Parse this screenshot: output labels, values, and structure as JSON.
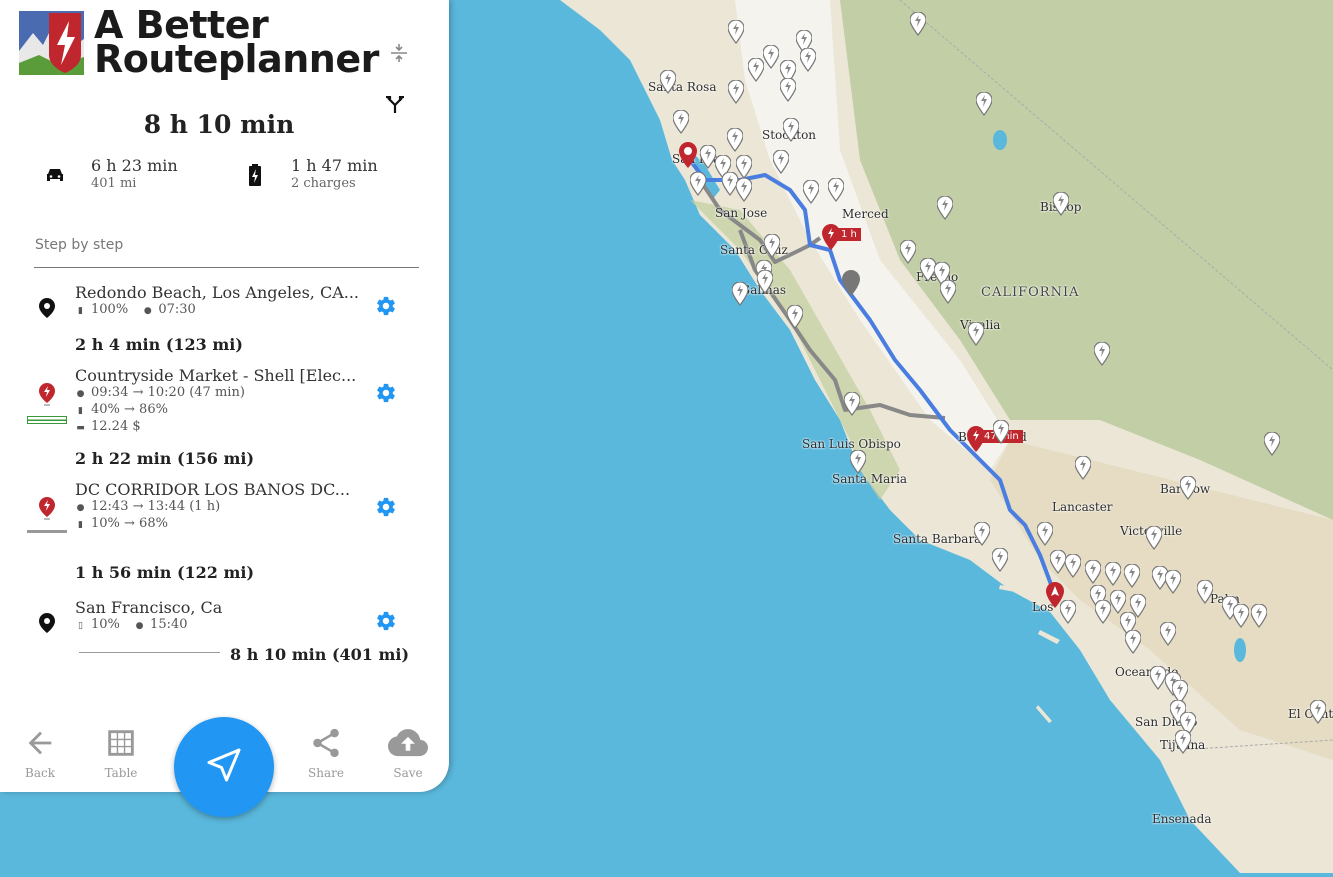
{
  "app": {
    "name": "A Better Routeplanner",
    "name_line1": "A Better",
    "name_line2": "Routeplanner"
  },
  "summary": {
    "total_time": "8 h 10 min",
    "drive_time": "6 h 23 min",
    "drive_distance": "401 mi",
    "charge_time": "1 h 47 min",
    "charge_count": "2 charges",
    "icons": [
      "car-icon",
      "battery-charging-icon",
      "collapse-icon",
      "alternative-route-icon"
    ]
  },
  "step_by_step_label": "Step by step",
  "stops": [
    {
      "title": "Redondo Beach, Los Angeles, CA...",
      "soc": "100%",
      "time": "07:30",
      "icon": "location-pin-icon"
    },
    {
      "title": "Countryside Market - Shell [Elec...",
      "times": "09:34 → 10:20 (47 min)",
      "soc": "40% → 86%",
      "cost": "12.24 $",
      "icon": "charger-pin-icon"
    },
    {
      "title": "DC CORRIDOR LOS BANOS DC...",
      "times": "12:43 → 13:44 (1 h)",
      "soc": "10% → 68%",
      "icon": "charger-pin-icon"
    },
    {
      "title": "San Francisco, Ca",
      "soc": "10%",
      "time": "15:40",
      "icon": "location-pin-icon"
    }
  ],
  "legs": [
    "2 h 4 min (123 mi)",
    "2 h 22 min (156 mi)",
    "1 h 56 min (122 mi)"
  ],
  "final_total": "8 h 10 min (401 mi)",
  "bottom_nav": {
    "back": "Back",
    "table": "Table",
    "share": "Share",
    "save": "Save"
  },
  "map": {
    "labels": [
      "Santa Rosa",
      "Stockton",
      "San Fra",
      "San Jose",
      "Merced",
      "Santa Cruz",
      "Salinas",
      "Fresno",
      "CALIFORNIA",
      "Visalia",
      "Bishop",
      "San Luis Obispo",
      "Bakersfield",
      "Santa Maria",
      "Lancaster",
      "Barstow",
      "Victorville",
      "Santa Barbara",
      "Los",
      "Palm",
      "Oceanside",
      "San Diego",
      "Tijuana",
      "El Centro",
      "Ensenada"
    ],
    "badges": [
      "1 h",
      "47 min"
    ],
    "colors": {
      "water": "#5ab8dc",
      "route": "#4a7de0",
      "alt_route": "#888888",
      "pin": "#c0262d",
      "accent": "#2196f3"
    }
  }
}
